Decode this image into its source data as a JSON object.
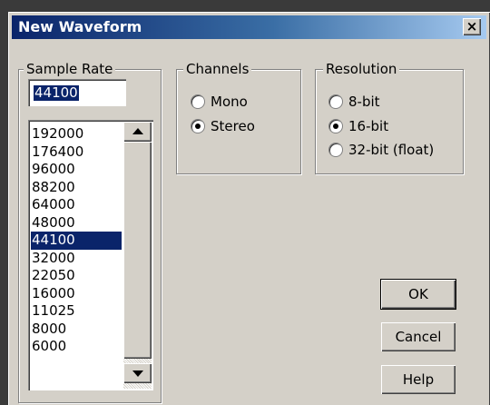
{
  "window": {
    "title": "New Waveform",
    "close_label": "×"
  },
  "sample_rate": {
    "label": "Sample Rate",
    "value": "44100",
    "options": [
      "192000",
      "176400",
      "96000",
      "88200",
      "64000",
      "48000",
      "44100",
      "32000",
      "22050",
      "16000",
      "11025",
      "8000",
      "6000"
    ],
    "selected": "44100"
  },
  "channels": {
    "label": "Channels",
    "options": [
      {
        "label": "Mono",
        "checked": false
      },
      {
        "label": "Stereo",
        "checked": true
      }
    ]
  },
  "resolution": {
    "label": "Resolution",
    "options": [
      {
        "label": "8-bit",
        "checked": false
      },
      {
        "label": "16-bit",
        "checked": true
      },
      {
        "label": "32-bit (float)",
        "checked": false
      }
    ]
  },
  "buttons": {
    "ok": "OK",
    "cancel": "Cancel",
    "help": "Help"
  },
  "colors": {
    "title_bar_start": "#0a246a",
    "title_bar_end": "#a6caf0",
    "dialog_face": "#d4d0c8",
    "selection": "#0a246a"
  }
}
